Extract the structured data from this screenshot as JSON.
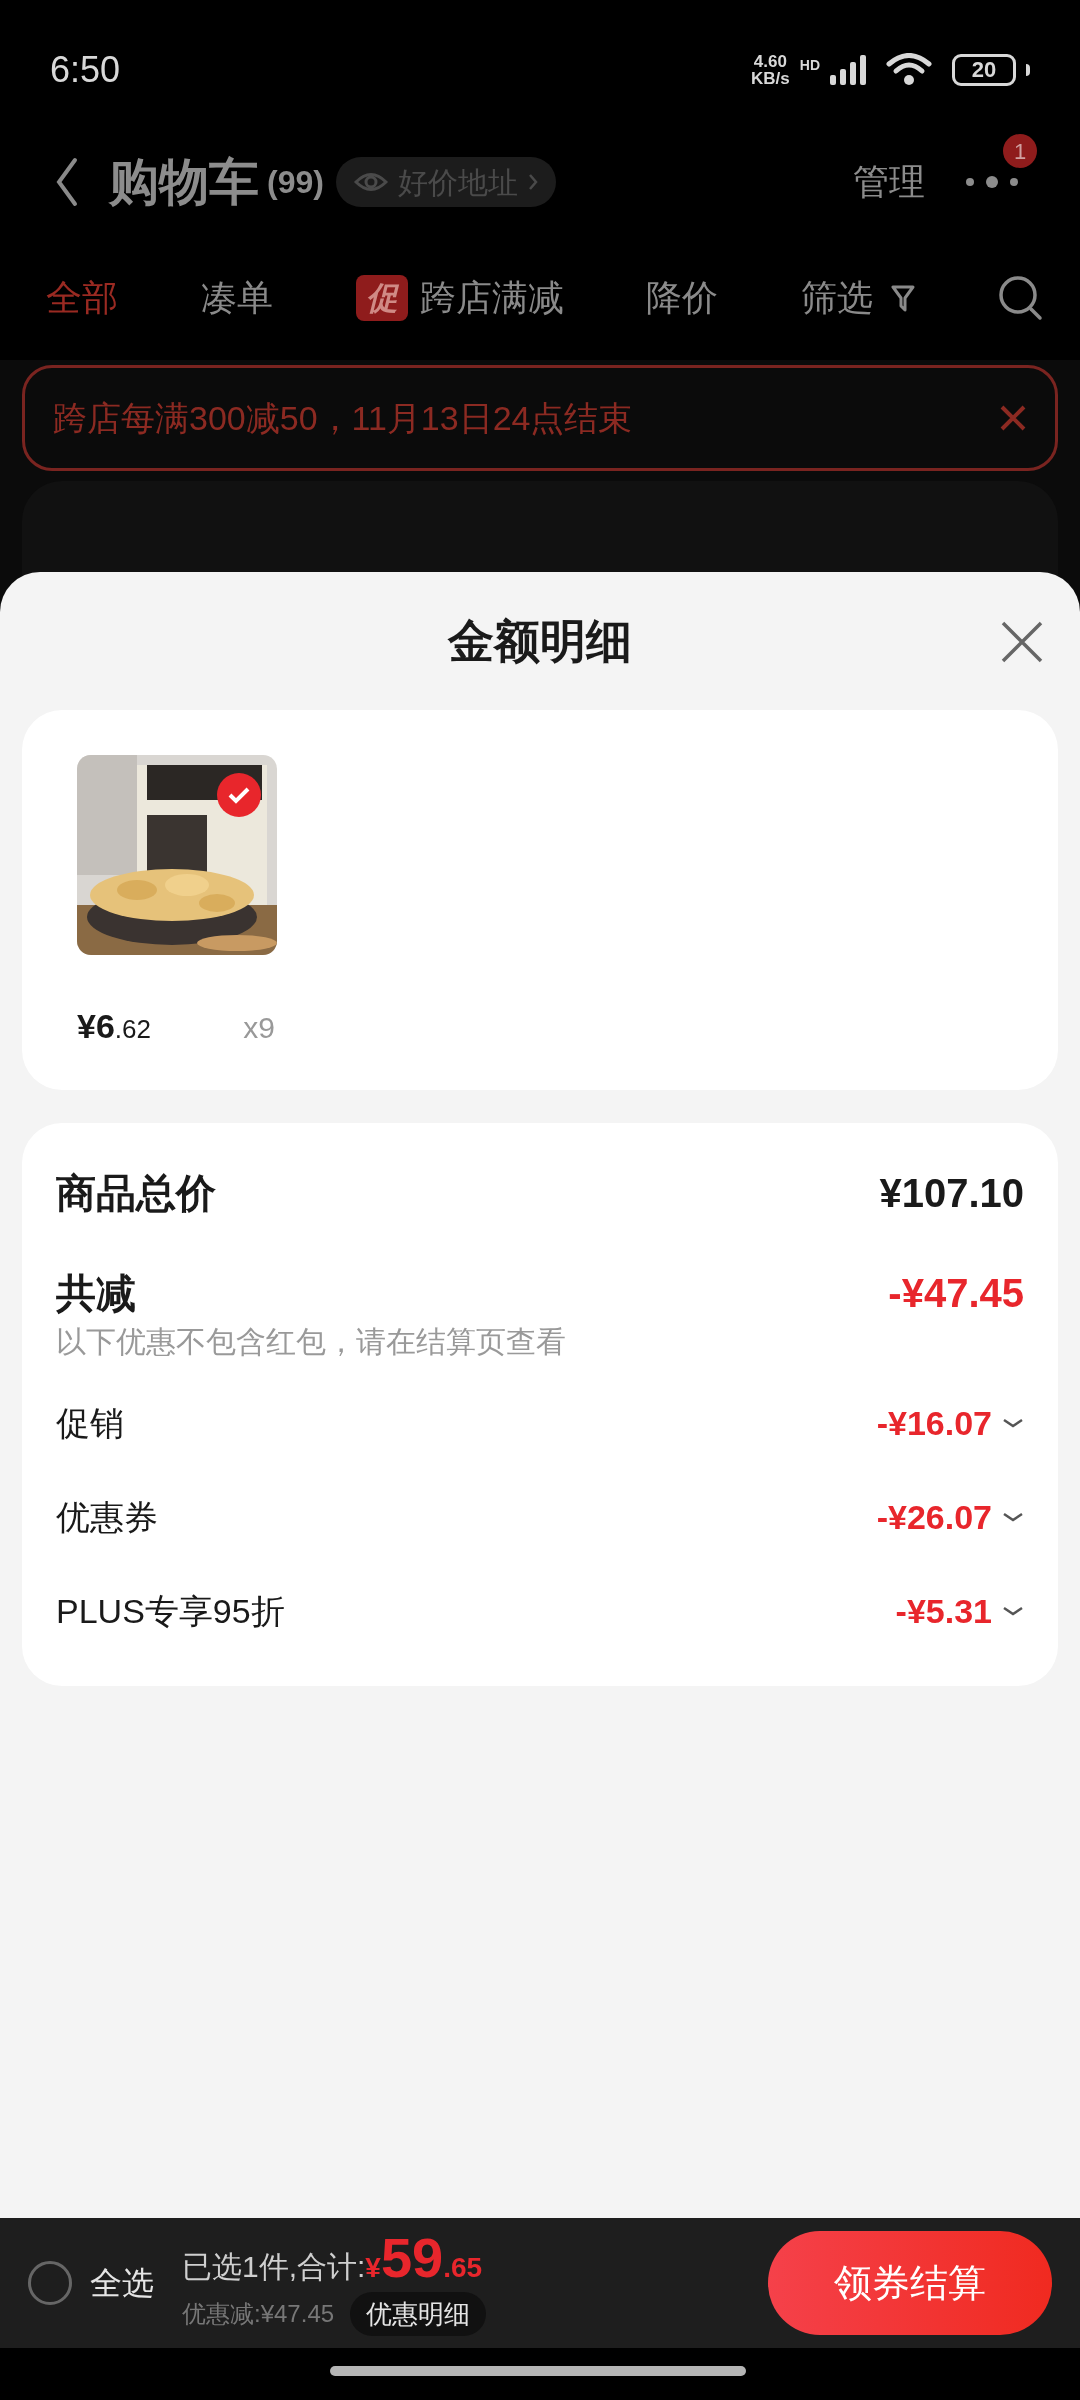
{
  "status_bar": {
    "time": "6:50",
    "net_speed": "4.60",
    "net_unit": "KB/s",
    "network": "HD",
    "battery": "20"
  },
  "header": {
    "title": "购物车",
    "count": "(99)",
    "address_chip": "好价地址",
    "manage": "管理",
    "notification_badge": "1"
  },
  "tabs": [
    {
      "label": "全部",
      "selected": true,
      "kind": "text"
    },
    {
      "label": "凑单",
      "selected": false,
      "kind": "text"
    },
    {
      "label": "跨店满减",
      "selected": false,
      "kind": "promo",
      "badge": "促"
    },
    {
      "label": "降价",
      "selected": false,
      "kind": "text"
    },
    {
      "label": "筛选",
      "selected": false,
      "kind": "filter"
    }
  ],
  "promo_banner": {
    "text": "跨店每满300减50，11月13日24点结束"
  },
  "sheet": {
    "title": "金额明细",
    "items": [
      {
        "kind": "picture",
        "selected": true,
        "price_int": "¥6",
        "price_dec": ".62",
        "quantity": "x9"
      }
    ],
    "summary": {
      "total_label": "商品总价",
      "total_value": "¥107.10",
      "discount_label": "共减",
      "discount_value": "-¥47.45",
      "note": "以下优惠不包含红包，请在结算页查看",
      "lines": [
        {
          "label": "促销",
          "value": "-¥16.07",
          "expanded": false
        },
        {
          "label": "优惠券",
          "value": "-¥26.07",
          "expanded": false
        },
        {
          "label": "PLUS专享95折",
          "value": "-¥5.31",
          "expanded": false
        }
      ]
    }
  },
  "bottom_bar": {
    "select_all": {
      "label": "全选",
      "checked": false
    },
    "summary": "已选1件,合计:",
    "currency": "¥",
    "total_int": "59",
    "total_dec": ".65",
    "discount": "优惠减:¥47.45",
    "detail_button": "优惠明细",
    "checkout": "领券结算"
  }
}
